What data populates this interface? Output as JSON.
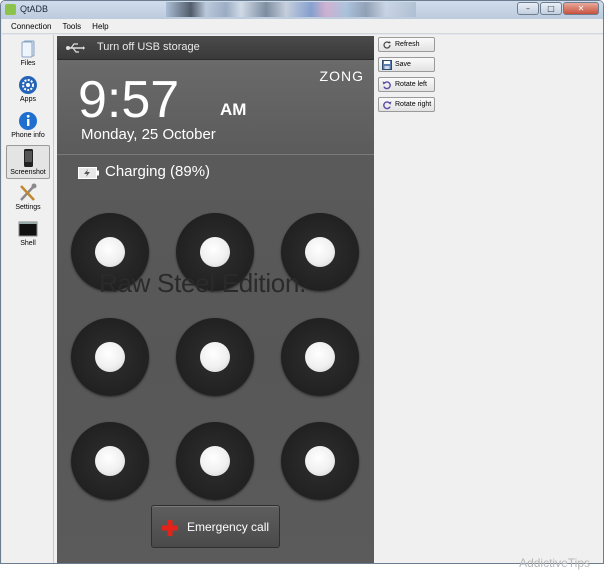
{
  "window": {
    "title": "QtADB",
    "controls": [
      "–",
      "□",
      "✕"
    ]
  },
  "menu": [
    "Connection",
    "Tools",
    "Help"
  ],
  "sidebar": {
    "items": [
      {
        "label": "Files",
        "icon": "files-icon"
      },
      {
        "label": "Apps",
        "icon": "apps-icon"
      },
      {
        "label": "Phone info",
        "icon": "info-icon"
      },
      {
        "label": "Screenshot",
        "icon": "phone-icon",
        "active": true
      },
      {
        "label": "Settings",
        "icon": "settings-icon"
      },
      {
        "label": "Shell",
        "icon": "shell-icon"
      }
    ]
  },
  "phone": {
    "status_bar": {
      "usb_text": "Turn off USB storage"
    },
    "carrier": "ZONG",
    "time": "9:57",
    "ampm": "AM",
    "date": "Monday, 25 October",
    "battery": "Charging (89%)",
    "overlay_text": "Raw Steel Edition.",
    "emergency_label": "Emergency call"
  },
  "actions": {
    "refresh": "Refresh",
    "save": "Save",
    "rotate_left": "Rotate left",
    "rotate_right": "Rotate right"
  },
  "watermark": "AddictiveTips",
  "colors": {
    "phone_bg": "#5a5a5a",
    "window_frame": "#dfe8f3",
    "emergency_cross": "#e2231a"
  }
}
